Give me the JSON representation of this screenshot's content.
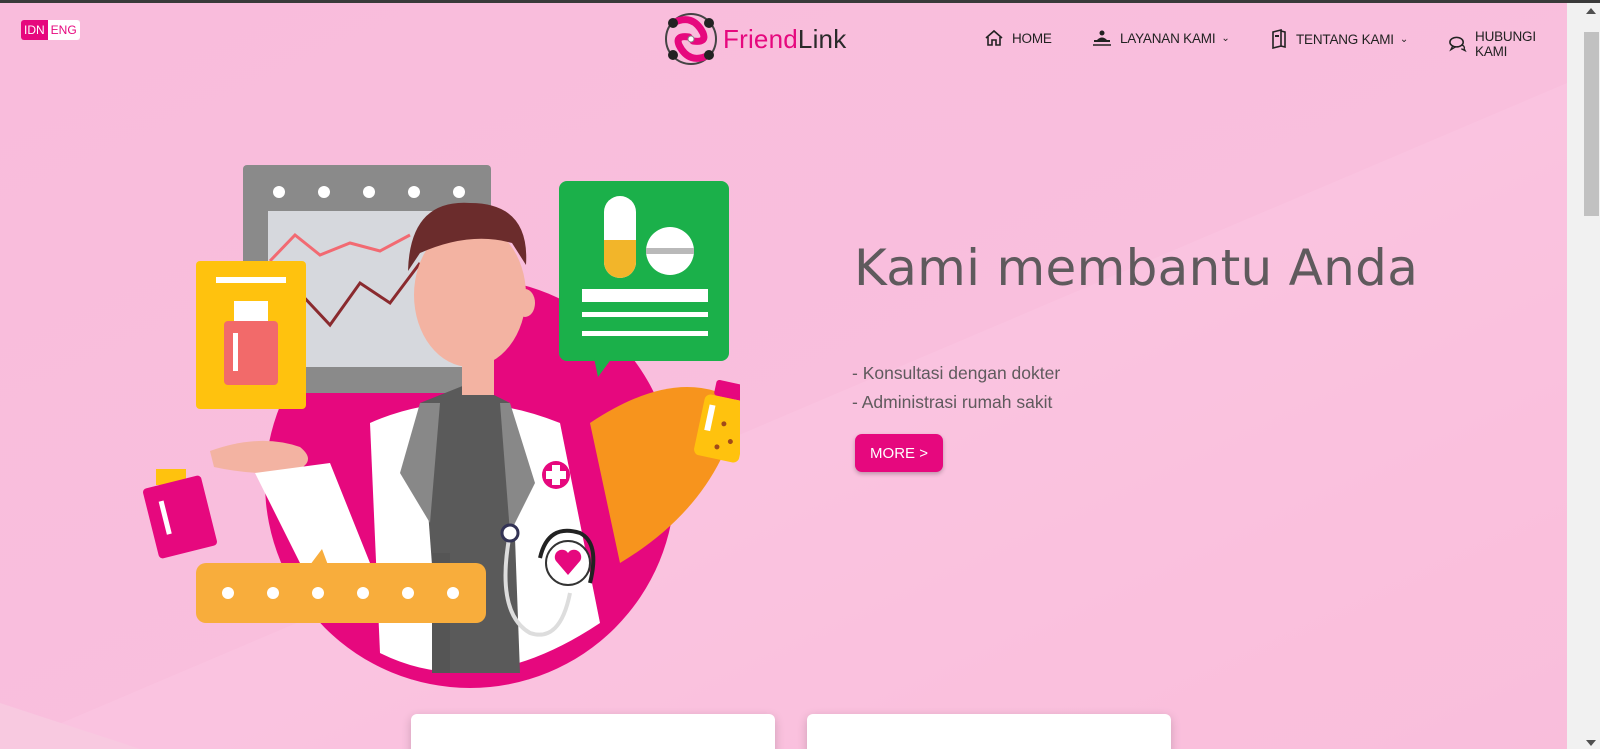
{
  "lang_switch": {
    "active": "IDN",
    "inactive": "ENG"
  },
  "brand": {
    "name_part1": "Friend",
    "name_part2": "Link",
    "accent": "#e6087e"
  },
  "nav": {
    "items": [
      {
        "label": "HOME",
        "icon": "home-icon"
      },
      {
        "label": "LAYANAN KAMI",
        "icon": "service-icon",
        "dropdown": true
      },
      {
        "label": "TENTANG KAMI",
        "icon": "book-icon",
        "dropdown": true
      },
      {
        "label": "HUBUNGI KAMI",
        "icon": "chat-icon"
      }
    ]
  },
  "hero": {
    "headline": "Kami membantu Anda",
    "bullets": [
      "- Konsultasi dengan dokter",
      "- Administrasi rumah sakit"
    ],
    "cta_label": "MORE >"
  },
  "cards": [
    {
      "title": ""
    },
    {
      "title": ""
    }
  ],
  "colors": {
    "background": "#f9bfdc",
    "button": "#e6087e",
    "text": "#5f5a5d"
  }
}
